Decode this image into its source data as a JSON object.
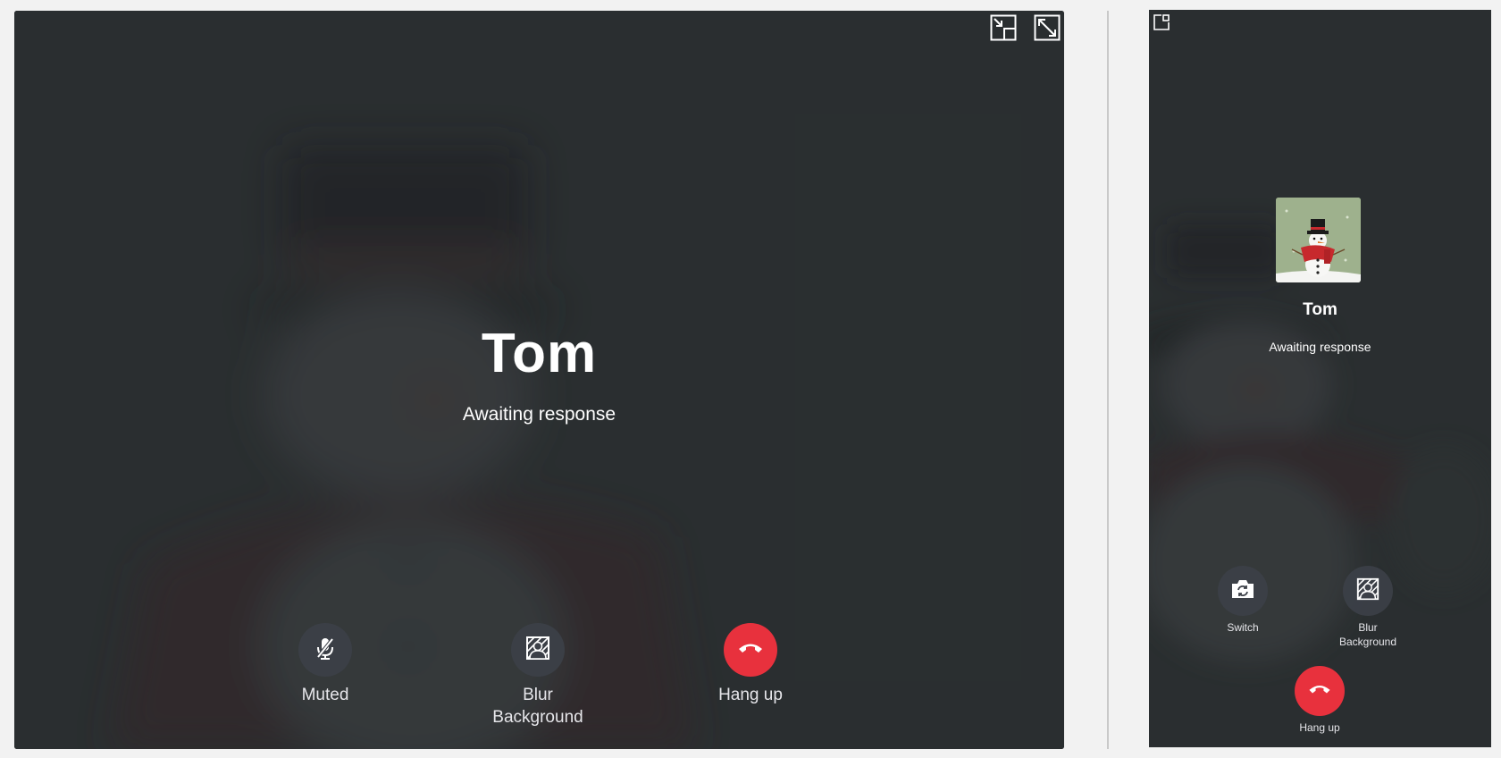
{
  "desktop": {
    "callee_name": "Tom",
    "call_status": "Awaiting response",
    "controls": {
      "mute_label": "Muted",
      "blur_label": "Blur\nBackground",
      "hangup_label": "Hang up"
    },
    "window_icons": [
      "minimize-window-icon",
      "fullscreen-icon"
    ]
  },
  "mobile": {
    "callee_name": "Tom",
    "call_status": "Awaiting response",
    "controls": {
      "switch_label": "Switch",
      "blur_label": "Blur\nBackground",
      "hangup_label": "Hang up"
    },
    "window_icons": [
      "floating-window-icon"
    ]
  },
  "colors": {
    "hangup": "#e8313d",
    "control_bg": "#3c4048",
    "panel_bg": "#2b2f30"
  }
}
